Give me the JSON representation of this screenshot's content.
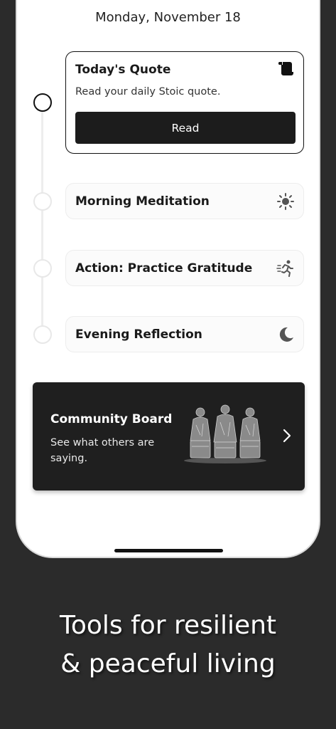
{
  "date": "Monday, November 18",
  "quote_card": {
    "title": "Today's Quote",
    "subtitle": "Read your daily Stoic quote.",
    "button_label": "Read",
    "icon": "scroll-icon"
  },
  "tasks": [
    {
      "title": "Morning Meditation",
      "icon": "sun-icon"
    },
    {
      "title": "Action: Practice Gratitude",
      "icon": "running-person-icon"
    },
    {
      "title": "Evening Reflection",
      "icon": "moon-icon"
    }
  ],
  "community": {
    "title": "Community Board",
    "subtitle": "See what others are saying.",
    "icon": "chevron-right-icon"
  },
  "tagline": {
    "line1": "Tools for resilient",
    "line2": "& peaceful living"
  },
  "colors": {
    "background": "#2b2b2b",
    "phone": "#ffffff",
    "accent_dark": "#1c1c1c"
  }
}
